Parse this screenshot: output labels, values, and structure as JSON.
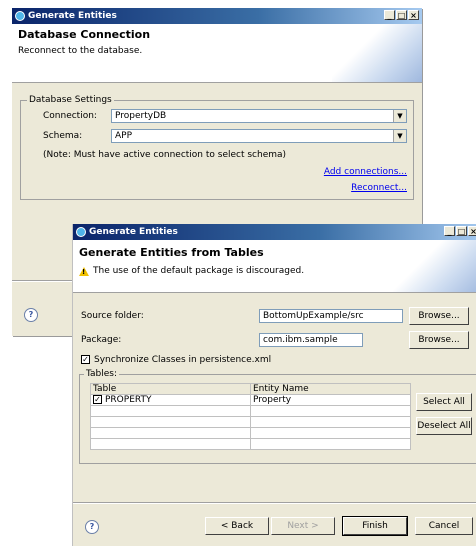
{
  "back_window": {
    "title": "Generate Entities",
    "header_title": "Database Connection",
    "header_subtitle": "Reconnect to the database.",
    "group_label": "Database Settings",
    "connection_label": "Connection:",
    "connection_value": "PropertyDB",
    "schema_label": "Schema:",
    "schema_value": "APP",
    "note": "(Note:  Must have active connection to select schema)",
    "add_connections": "Add connections...",
    "reconnect": "Reconnect...",
    "help": "?"
  },
  "front_window": {
    "title": "Generate Entities",
    "header_title": "Generate Entities from Tables",
    "header_warning": "The use of the default package is discouraged.",
    "source_folder_label": "Source folder:",
    "source_folder_value": "BottomUpExample/src",
    "package_label": "Package:",
    "package_value": "com.ibm.sample",
    "browse_label": "Browse...",
    "sync_label": "Synchronize Classes in persistence.xml",
    "tables_label": "Tables:",
    "table_headers": [
      "Table",
      "Entity Name"
    ],
    "table_rows": [
      {
        "table": "PROPERTY",
        "entity": "Property"
      }
    ],
    "select_all": "Select All",
    "deselect_all": "Deselect All",
    "back": "< Back",
    "next": "Next >",
    "finish": "Finish",
    "cancel": "Cancel",
    "help": "?"
  },
  "titlebar_buttons": {
    "minimize": "_",
    "maximize": "□",
    "close": "×"
  }
}
